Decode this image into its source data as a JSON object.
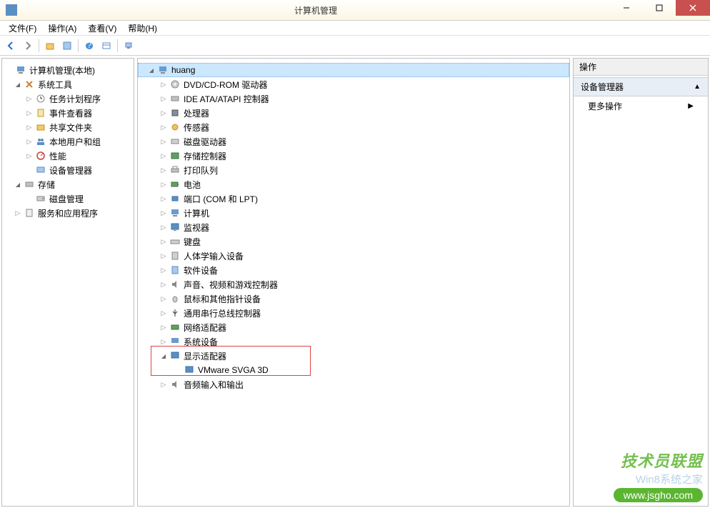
{
  "window": {
    "title": "计算机管理"
  },
  "menu": {
    "file": "文件(F)",
    "action": "操作(A)",
    "view": "查看(V)",
    "help": "帮助(H)"
  },
  "left_tree": {
    "root": "计算机管理(本地)",
    "system_tools": "系统工具",
    "task_scheduler": "任务计划程序",
    "event_viewer": "事件查看器",
    "shared_folders": "共享文件夹",
    "local_users": "本地用户和组",
    "performance": "性能",
    "device_manager": "设备管理器",
    "storage": "存储",
    "disk_mgmt": "磁盘管理",
    "services_apps": "服务和应用程序"
  },
  "mid_tree": {
    "host": "huang",
    "dvd": "DVD/CD-ROM 驱动器",
    "ide": "IDE ATA/ATAPI 控制器",
    "cpu": "处理器",
    "sensor": "传感器",
    "disk_drives": "磁盘驱动器",
    "storage_ctrl": "存储控制器",
    "print_queue": "打印队列",
    "battery": "电池",
    "ports": "端口 (COM 和 LPT)",
    "computer": "计算机",
    "monitor": "监视器",
    "keyboard": "键盘",
    "hid": "人体学输入设备",
    "software_dev": "软件设备",
    "sound": "声音、视频和游戏控制器",
    "mouse": "鼠标和其他指针设备",
    "usb": "通用串行总线控制器",
    "network": "网络适配器",
    "system_dev": "系统设备",
    "display_adapter": "显示适配器",
    "vmware_svga": "VMware SVGA 3D",
    "audio_io": "音频输入和输出"
  },
  "right_panel": {
    "header": "操作",
    "section": "设备管理器",
    "more_actions": "更多操作"
  },
  "watermark": {
    "title": "技术员联盟",
    "sub": "Win8系统之家",
    "url": "www.jsgho.com"
  }
}
